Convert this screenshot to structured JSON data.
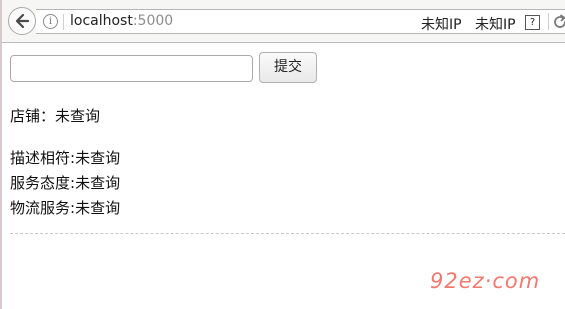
{
  "browser": {
    "url_host": "localhost",
    "url_port": ":5000",
    "ip_label_1": "未知IP",
    "ip_label_2": "未知IP",
    "help_glyph": "?",
    "icons": {
      "back": "back-arrow-icon",
      "info": "info-icon",
      "help": "help-icon",
      "reload": "reload-icon"
    }
  },
  "form": {
    "input_value": "",
    "submit_label": "提交"
  },
  "shop": {
    "label": "店铺：",
    "value": "未查询"
  },
  "ratings": [
    {
      "label": "描述相符:",
      "value": "未查询"
    },
    {
      "label": "服务态度:",
      "value": "未查询"
    },
    {
      "label": "物流服务:",
      "value": "未查询"
    }
  ],
  "watermark": "92ez·com",
  "colors": {
    "watermark": "#f07a6f",
    "toolbar_bg": "#f6f6f5"
  }
}
